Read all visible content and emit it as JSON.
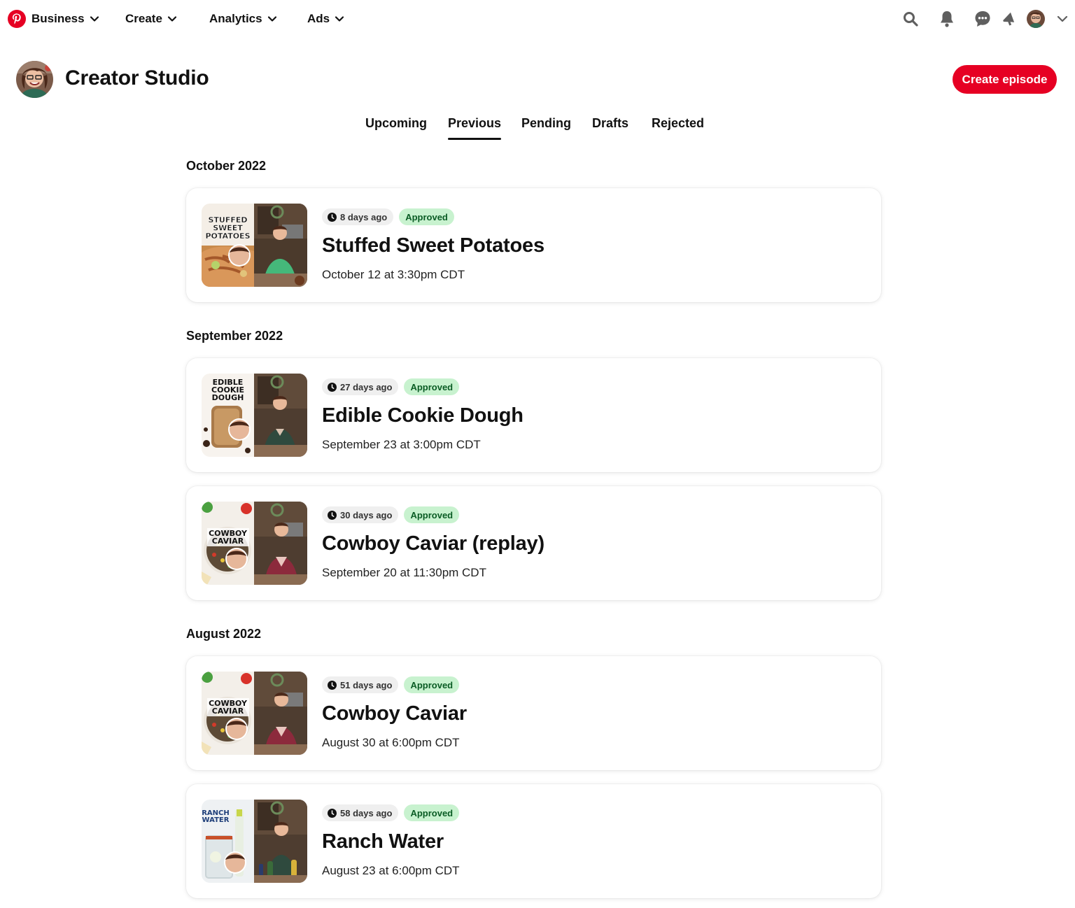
{
  "nav": {
    "items": [
      {
        "label": "Business"
      },
      {
        "label": "Create"
      },
      {
        "label": "Analytics"
      },
      {
        "label": "Ads"
      }
    ],
    "icons": [
      "search-icon",
      "notifications-bell-icon",
      "messages-icon",
      "updates-megaphone-icon",
      "account-chevron-icon"
    ]
  },
  "header": {
    "title": "Creator Studio",
    "create_button": "Create episode"
  },
  "tabs": [
    {
      "label": "Upcoming",
      "active": false
    },
    {
      "label": "Previous",
      "active": true
    },
    {
      "label": "Pending",
      "active": false
    },
    {
      "label": "Drafts",
      "active": false
    },
    {
      "label": "Rejected",
      "active": false
    }
  ],
  "sections": [
    {
      "month": "October 2022",
      "episodes": [
        {
          "thumb_text": [
            "STUFFED",
            "SWEET",
            "POTATOES"
          ],
          "ago": "8 days ago",
          "status": "Approved",
          "title": "Stuffed Sweet Potatoes",
          "date": "October 12 at 3:30pm CDT"
        }
      ]
    },
    {
      "month": "September 2022",
      "episodes": [
        {
          "thumb_text": [
            "EDIBLE",
            "COOKIE",
            "DOUGH"
          ],
          "ago": "27 days ago",
          "status": "Approved",
          "title": "Edible Cookie Dough",
          "date": "September 23 at 3:00pm CDT"
        },
        {
          "thumb_text": [
            "COWBOY",
            "CAVIAR"
          ],
          "ago": "30 days ago",
          "status": "Approved",
          "title": "Cowboy Caviar (replay)",
          "date": "September 20 at 11:30pm CDT"
        }
      ]
    },
    {
      "month": "August 2022",
      "episodes": [
        {
          "thumb_text": [
            "COWBOY",
            "CAVIAR"
          ],
          "ago": "51 days ago",
          "status": "Approved",
          "title": "Cowboy Caviar",
          "date": "August 30 at 6:00pm CDT"
        },
        {
          "thumb_text": [
            "RANCH",
            "WATER"
          ],
          "ago": "58 days ago",
          "status": "Approved",
          "title": "Ranch Water",
          "date": "August 23 at 6:00pm CDT"
        }
      ]
    }
  ],
  "colors": {
    "brand_red": "#e60023",
    "approved_bg": "#c8f2cf",
    "approved_text": "#0a5c24",
    "pill_bg": "#efefef"
  }
}
